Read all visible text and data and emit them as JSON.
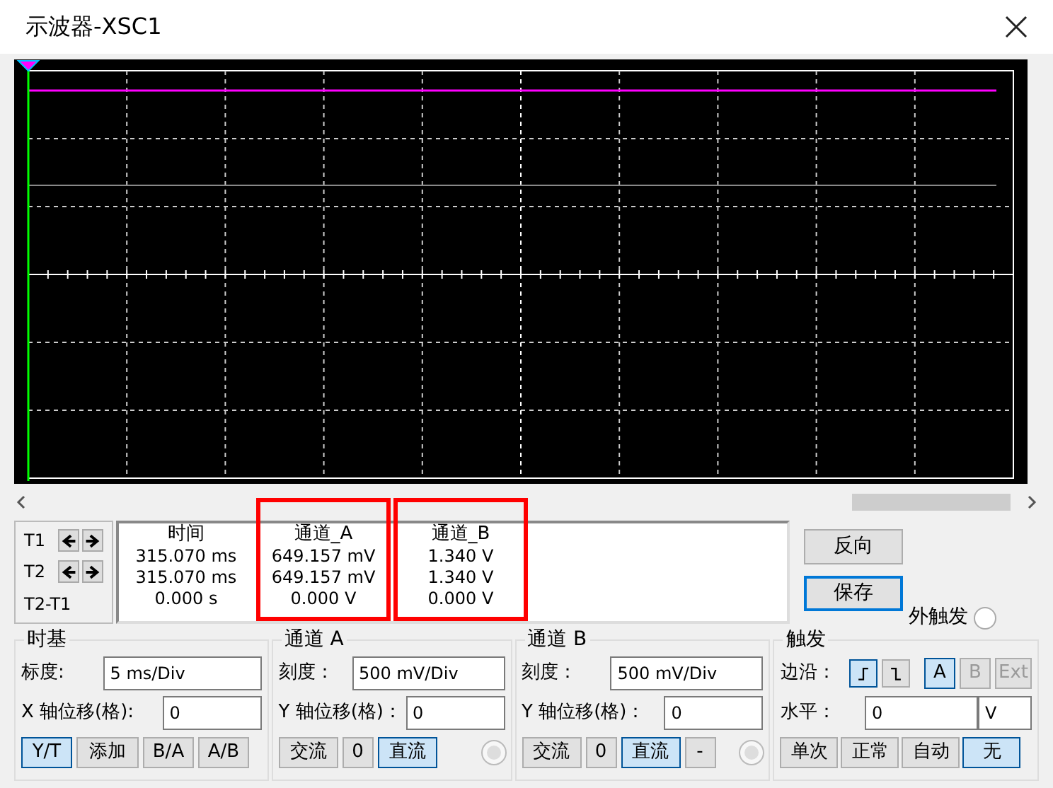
{
  "window": {
    "title": "示波器-XSC1"
  },
  "cursors": [
    {
      "label": "T1",
      "kind": "arrows"
    },
    {
      "label": "T2",
      "kind": "arrows"
    },
    {
      "label": "T2-T1",
      "kind": "plain"
    }
  ],
  "readout": {
    "columns": [
      {
        "heading": "时间",
        "values": [
          "315.070 ms",
          "315.070 ms",
          "0.000 s"
        ]
      },
      {
        "heading": "通道_A",
        "values": [
          "649.157 mV",
          "649.157 mV",
          "0.000 V"
        ]
      },
      {
        "heading": "通道_B",
        "values": [
          "1.340 V",
          "1.340 V",
          "0.000 V"
        ]
      }
    ]
  },
  "buttons": [
    {
      "label": "反向",
      "focused": false
    },
    {
      "label": "保存",
      "focused": true
    }
  ],
  "external_trigger": {
    "label": "外触发",
    "selected": false,
    "disabled": false
  },
  "timebase": {
    "title": "时基",
    "scale_label": "标度:",
    "scale_value": "5 ms/Div",
    "offset_label": "X 轴位移(格):",
    "offset_value": "0",
    "modes": [
      {
        "label": "Y/T",
        "selected": true
      },
      {
        "label": "添加",
        "selected": false
      },
      {
        "label": "B/A",
        "selected": false
      },
      {
        "label": "A/B",
        "selected": false
      }
    ]
  },
  "channels": [
    {
      "title": "通道 A",
      "scale_label": "刻度：",
      "scale_value": "500 mV/Div",
      "offset_label": "Y 轴位移(格)：",
      "offset_value": "0",
      "coupling": [
        {
          "label": "交流",
          "selected": false
        },
        {
          "label": "0",
          "selected": false
        },
        {
          "label": "直流",
          "selected": true
        }
      ],
      "radio": {
        "selected": false,
        "disabled": true
      }
    },
    {
      "title": "通道 B",
      "scale_label": "刻度：",
      "scale_value": "500 mV/Div",
      "offset_label": "Y 轴位移(格)：",
      "offset_value": "0",
      "coupling": [
        {
          "label": "交流",
          "selected": false
        },
        {
          "label": "0",
          "selected": false
        },
        {
          "label": "直流",
          "selected": true
        },
        {
          "label": "-",
          "selected": false
        }
      ],
      "radio": {
        "selected": false,
        "disabled": true
      }
    }
  ],
  "trigger": {
    "title": "触发",
    "edge_label": "边沿：",
    "edges": [
      {
        "kind": "rising",
        "selected": true
      },
      {
        "kind": "falling",
        "selected": false
      }
    ],
    "sources": [
      {
        "label": "A",
        "selected": true,
        "disabled": false
      },
      {
        "label": "B",
        "selected": false,
        "disabled": true
      },
      {
        "label": "Ext",
        "selected": false,
        "disabled": true
      }
    ],
    "level_label": "水平：",
    "level_value": "0",
    "level_unit": "V",
    "modes": [
      {
        "label": "单次",
        "selected": false
      },
      {
        "label": "正常",
        "selected": false
      },
      {
        "label": "自动",
        "selected": false
      },
      {
        "label": "无",
        "selected": true
      }
    ]
  }
}
